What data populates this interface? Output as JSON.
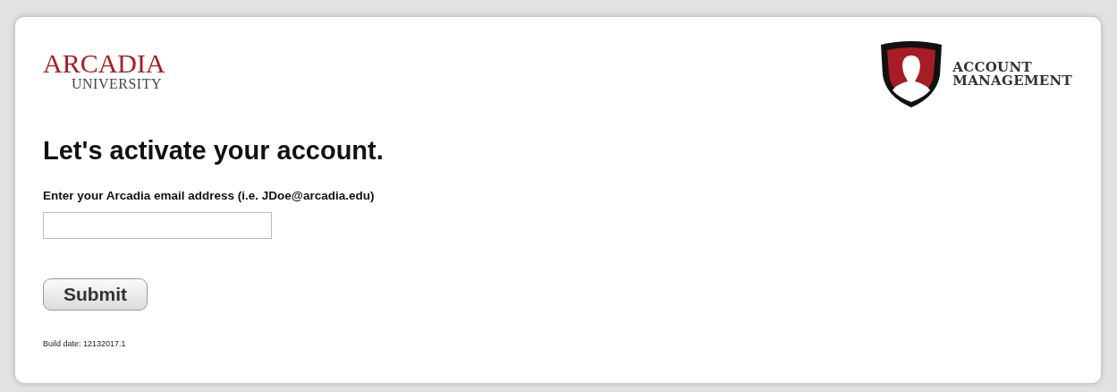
{
  "logo": {
    "line_1": "ARCADIA",
    "line_2": "UNIVERSITY"
  },
  "badge": {
    "line_1": "ACCOUNT",
    "line_2": "MANAGEMENT"
  },
  "heading": "Let's activate your account.",
  "email_field": {
    "label": "Enter your Arcadia email address (i.e. JDoe@arcadia.edu)"
  },
  "submit_button": "Submit",
  "build_date": "Build date: 12132017.1"
}
